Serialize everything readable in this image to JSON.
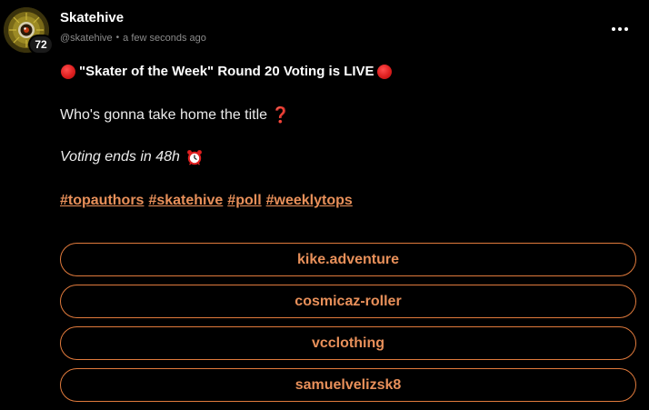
{
  "author": {
    "display_name": "Skatehive",
    "handle": "@skatehive",
    "separator": "•",
    "timestamp": "a few seconds ago",
    "reputation": "72",
    "avatar_icon": "skatehive-logo-icon"
  },
  "menu": {
    "more_icon": "more-horizontal-icon"
  },
  "post": {
    "headline": "\"Skater of the Week\" Round 20 Voting is LIVE",
    "headline_icon": "red-circle-icon",
    "question": "Who's gonna take home the title",
    "question_icon": "❓",
    "voting_ends": "Voting ends in 48h",
    "voting_icon": "alarm-clock-icon",
    "hashtags": [
      "#topauthors",
      "#skatehive",
      "#poll",
      "#weeklytops"
    ]
  },
  "poll": {
    "options": [
      "kike.adventure",
      "cosmicaz-roller",
      "vcclothing",
      "samuelvelizsk8"
    ]
  },
  "colors": {
    "background": "#000000",
    "accent": "#e8905a",
    "poll_border": "#e07a3c",
    "muted": "#8b8b8b",
    "red": "#dd1f1f"
  }
}
